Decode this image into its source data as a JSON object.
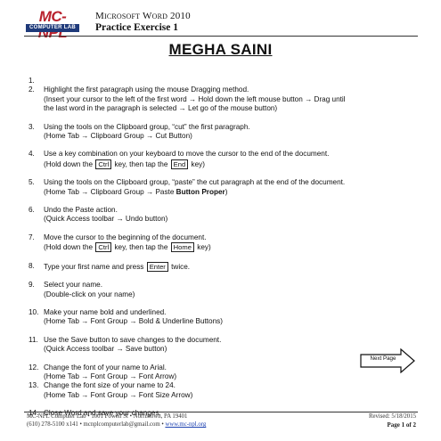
{
  "header": {
    "logo_text": "MC-NPL",
    "logo_sub": "COMPUTER LAB",
    "title": "Microsoft Word 2010",
    "subtitle": "Practice Exercise 1"
  },
  "main_title": "MEGHA SAINI",
  "steps": [
    {
      "num": "1.",
      "lines": [
        ""
      ]
    },
    {
      "num": "2.",
      "line1": "Highlight the first paragraph  using the mouse Dragging method.",
      "line2": "(Insert your cursor to the left of the first word → Hold down the left mouse button → Drag until",
      "line3": "the last word in the paragraph is selected → Let go of the mouse button)"
    },
    {
      "num": "3.",
      "line1": "Using the tools on the Clipboard group, “cut” the first paragraph.",
      "line2": "(Home Tab → Clipboard Group → Cut Button)"
    },
    {
      "num": "4.",
      "line1": "Use a key combination on your keyboard to move the cursor to the end of the document.",
      "line2a": "(Hold down the",
      "key1": "Ctrl",
      "line2b": "key, then tap the",
      "key2": "End",
      "line2c": "key)"
    },
    {
      "num": "5.",
      "line1": "Using the tools on the Clipboard group, “paste” the cut paragraph  at the end of the document.",
      "line2a": "(Home Tab → Clipboard Group → Paste",
      "line2bold": "Button Proper",
      "line2c": ")"
    },
    {
      "num": "6.",
      "line1": "Undo the Paste action.",
      "line2": "(Quick Access toolbar → Undo button)"
    },
    {
      "num": "7.",
      "line1": "Move the cursor to the beginning of the document.",
      "line2a": "(Hold down the",
      "key1": "Ctrl",
      "line2b": "key, then tap the",
      "key2": "Home",
      "line2c": "key)"
    },
    {
      "num": "8.",
      "line1a": "Type your first name and press",
      "key1": "Enter",
      "line1b": "twice."
    },
    {
      "num": "9.",
      "line1": "Select your name.",
      "line2": "(Double-click  on your name)"
    },
    {
      "num": "10.",
      "line1": "Make your name bold and underlined.",
      "line2": "(Home Tab → Font Group → Bold & Underline Buttons)"
    },
    {
      "num": "11.",
      "line1": "Use the Save button to save changes to the document.",
      "line2": "(Quick Access toolbar → Save button)"
    },
    {
      "num": "12.",
      "line1": "Change the font of your name to Arial.",
      "line2": "(Home Tab → Font Group → Font Arrow)"
    },
    {
      "num": "13.",
      "line1": "Change the font size of your name to 24.",
      "line2": "(Home Tab → Font Group → Font Size Arrow)"
    },
    {
      "num": "14.",
      "line1": "Close Word and save your changes."
    }
  ],
  "next_page": "Next Page",
  "footer": {
    "left1": "MC-NPL Computer Lab  •  1001 Powell St  •  Norristown, PA 19401",
    "left2a": "(610) 278-5100 x141  •  mcnplcomputerlab@gmail.com  •",
    "left2link": "www.mc-npl.org",
    "right1": "Revised: 5/18/2015",
    "right2": "Page 1 of 2"
  },
  "colors": {
    "logo_red": "#b8202c",
    "logo_blue": "#1f3a7a",
    "link": "#1a3fb0"
  }
}
